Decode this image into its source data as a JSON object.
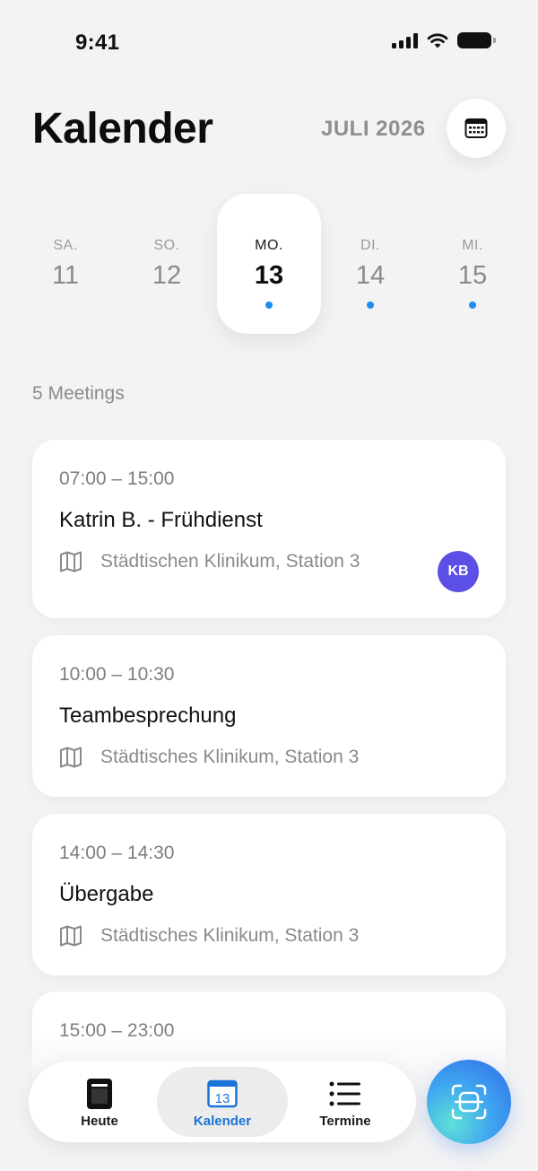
{
  "status_bar": {
    "time": "9:41"
  },
  "header": {
    "title": "Kalender",
    "month": "JULI 2026",
    "calendar_button_icon": "calendar-grid-icon"
  },
  "days": [
    {
      "name": "SA.",
      "number": "11",
      "has_events": false,
      "selected": false
    },
    {
      "name": "SO.",
      "number": "12",
      "has_events": false,
      "selected": false
    },
    {
      "name": "MO.",
      "number": "13",
      "has_events": true,
      "selected": true
    },
    {
      "name": "DI.",
      "number": "14",
      "has_events": true,
      "selected": false
    },
    {
      "name": "MI.",
      "number": "15",
      "has_events": true,
      "selected": false
    }
  ],
  "meetings_count": "5 Meetings",
  "meetings": [
    {
      "time": "07:00 – 15:00",
      "title": "Katrin B. - Frühdienst",
      "location": "Städtischen Klinikum, Station 3",
      "avatar": "KB"
    },
    {
      "time": "10:00 – 10:30",
      "title": "Teambesprechung",
      "location": "Städtisches Klinikum, Station 3"
    },
    {
      "time": "14:00 – 14:30",
      "title": "Übergabe",
      "location": "Städtisches Klinikum, Station 3"
    },
    {
      "time": "15:00 – 23:00"
    }
  ],
  "tabbar": {
    "tabs": [
      {
        "label": "Heute",
        "icon": "phone-icon",
        "active": false
      },
      {
        "label": "Kalender",
        "icon": "calendar-icon",
        "icon_text": "13",
        "active": true
      },
      {
        "label": "Termine",
        "icon": "list-icon",
        "active": false
      }
    ],
    "scan_button_icon": "scan-icon"
  },
  "colors": {
    "accent": "#1d8cf0",
    "active_tab": "#1a73d6",
    "avatar": "#5b4fe6"
  }
}
